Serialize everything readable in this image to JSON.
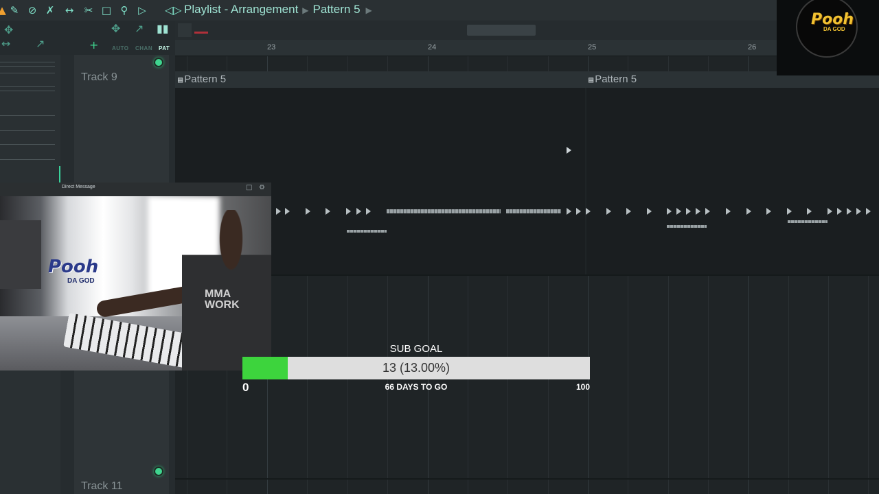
{
  "toolbar": {
    "icons": [
      "magnet-icon",
      "draw-icon",
      "delete-icon",
      "mute-icon",
      "slip-icon",
      "slice-icon",
      "select-icon",
      "zoom-icon",
      "playback-icon"
    ],
    "title": "Playlist - Arrangement",
    "pattern": "Pattern 5"
  },
  "toolbar2": {
    "modes": [
      "AUTO",
      "CHAN",
      "PAT"
    ],
    "active_mode": "PAT"
  },
  "ruler": {
    "numbers": [
      "23",
      "24",
      "25",
      "26"
    ]
  },
  "tracks": {
    "track_top": "Track 9",
    "track_bottom": "Track 11"
  },
  "clips": {
    "left_label": "Pattern 5",
    "right_label": "Pattern 5",
    "badge": "▤"
  },
  "webcam": {
    "window_title": "Direct Message",
    "logo_text": "Pooh",
    "logo_sub": "DA GOD",
    "shirt_text": "MMA\nWORK"
  },
  "logo": {
    "text": "Pooh",
    "sub": "DA GOD"
  },
  "sub_goal": {
    "label": "SUB GOAL",
    "value_text": "13 (13.00%)",
    "progress": 0.13,
    "min": "0",
    "max": "100",
    "days_text": "66 DAYS TO GO"
  },
  "colors": {
    "accent": "#7fe0c8",
    "progress_fill": "#3dd43d",
    "led": "#3fd58f",
    "logo_gold": "#f1c232"
  }
}
